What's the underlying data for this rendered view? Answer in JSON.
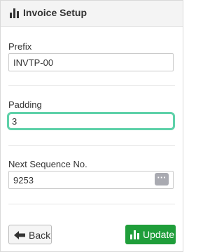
{
  "header": {
    "title": "Invoice Setup",
    "icon": "bar-chart-icon"
  },
  "fields": {
    "prefix": {
      "label": "Prefix",
      "value": "INVTP-00"
    },
    "padding": {
      "label": "Padding",
      "value": "3"
    },
    "next_sequence": {
      "label": "Next Sequence No.",
      "value": "9253",
      "action_icon": "ellipsis-icon",
      "action_glyph": "···"
    }
  },
  "buttons": {
    "back_label": "Back",
    "back_icon": "arrow-left-icon",
    "update_label": "Update",
    "update_icon": "bar-chart-icon"
  },
  "colors": {
    "focus_border": "#5ed1a9",
    "update_bg": "#1f9e3a",
    "header_bg": "#f4f4f4"
  }
}
